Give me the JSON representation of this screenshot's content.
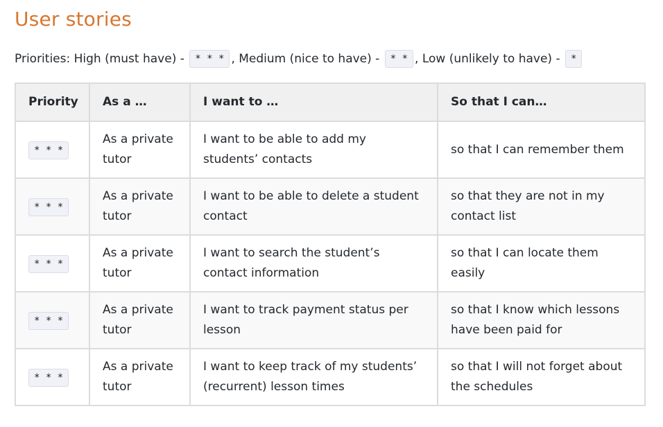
{
  "heading": "User stories",
  "legend": {
    "prefix": "Priorities: High (must have) -",
    "high_code": "* * *",
    "mid_text": ", Medium (nice to have) -",
    "medium_code": "* *",
    "low_text": ", Low (unlikely to have) -",
    "low_code": "*"
  },
  "table": {
    "headers": [
      "Priority",
      "As a …",
      "I want to …",
      "So that I can…"
    ],
    "rows": [
      {
        "priority": "* * *",
        "as_a": "As a private tutor",
        "want": "I want to be able to add my students’ contacts",
        "so_that": "so that I can remember them"
      },
      {
        "priority": "* * *",
        "as_a": "As a private tutor",
        "want": "I want to be able to delete a student contact",
        "so_that": "so that they are not in my contact list"
      },
      {
        "priority": "* * *",
        "as_a": "As a private tutor",
        "want": "I want to search the student’s contact information",
        "so_that": "so that I can locate them easily"
      },
      {
        "priority": "* * *",
        "as_a": "As a private tutor",
        "want": "I want to track payment status per lesson",
        "so_that": "so that I know which lessons have been paid for"
      },
      {
        "priority": "* * *",
        "as_a": "As a private tutor",
        "want": "I want to keep track of my students’ (recurrent) lesson times",
        "so_that": "so that I will not forget about the schedules"
      }
    ]
  }
}
